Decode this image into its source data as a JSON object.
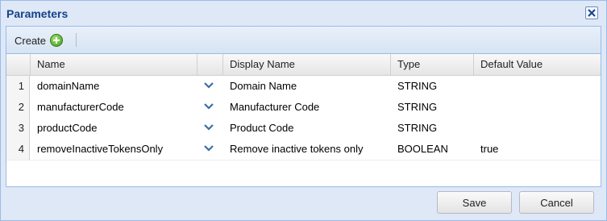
{
  "dialog": {
    "title": "Parameters"
  },
  "toolbar": {
    "create_label": "Create"
  },
  "columns": [
    "Name",
    "Display Name",
    "Type",
    "Default Value"
  ],
  "rows": [
    {
      "num": "1",
      "name": "domainName",
      "display_name": "Domain Name",
      "type": "STRING",
      "default_value": ""
    },
    {
      "num": "2",
      "name": "manufacturerCode",
      "display_name": "Manufacturer Code",
      "type": "STRING",
      "default_value": ""
    },
    {
      "num": "3",
      "name": "productCode",
      "display_name": "Product Code",
      "type": "STRING",
      "default_value": ""
    },
    {
      "num": "4",
      "name": "removeInactiveTokensOnly",
      "display_name": "Remove inactive tokens only",
      "type": "BOOLEAN",
      "default_value": "true"
    }
  ],
  "footer": {
    "save_label": "Save",
    "cancel_label": "Cancel"
  },
  "colors": {
    "title": "#15428b",
    "border": "#99bbe8",
    "chevron": "#3a6ea5"
  }
}
